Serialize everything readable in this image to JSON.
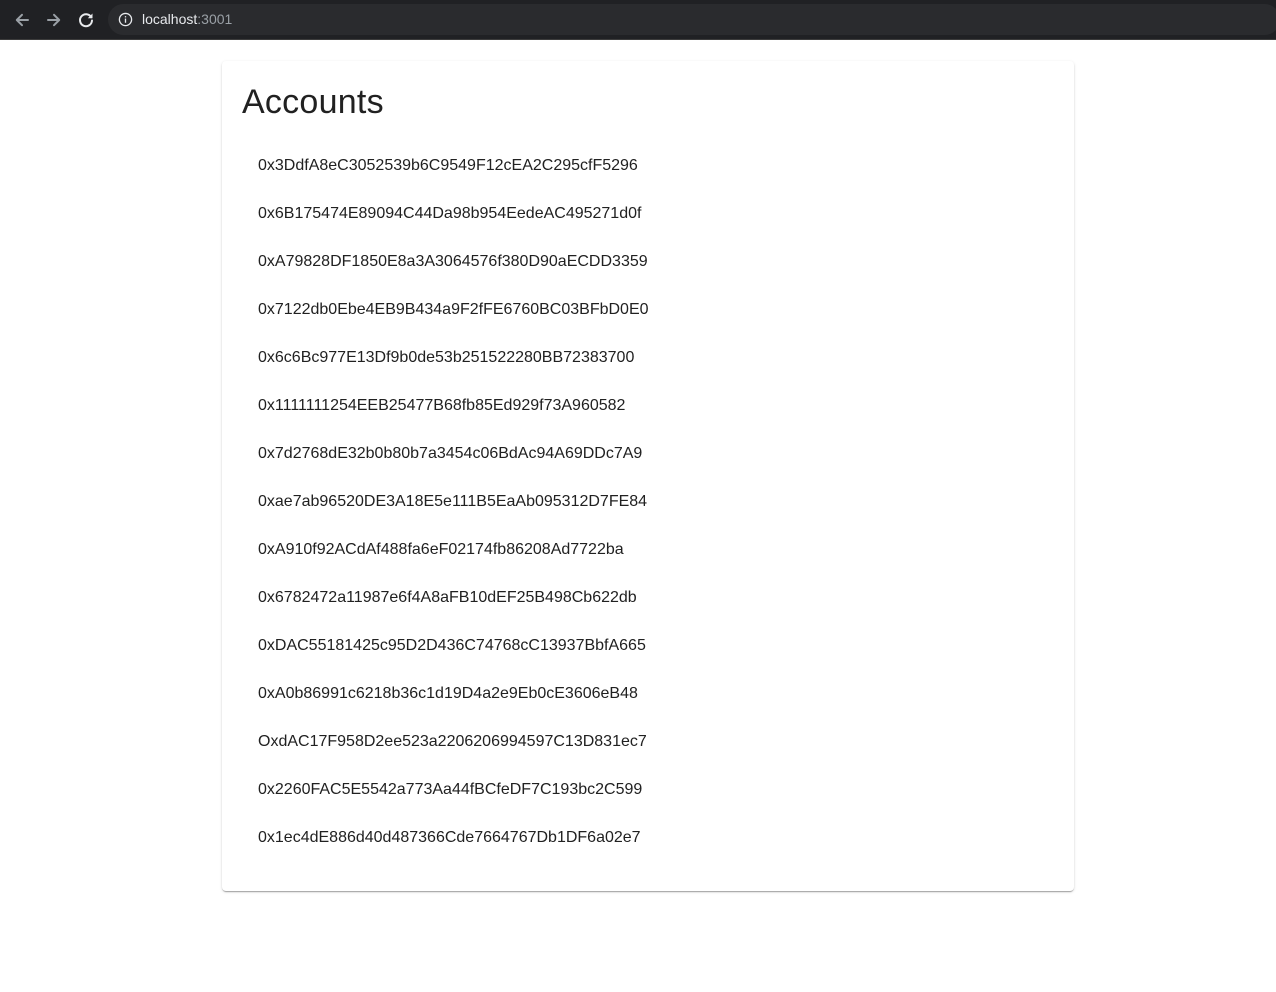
{
  "browser": {
    "url_host": "localhost",
    "url_port": ":3001"
  },
  "page": {
    "title": "Accounts",
    "accounts": [
      "0x3DdfA8eC3052539b6C9549F12cEA2C295cfF5296",
      "0x6B175474E89094C44Da98b954EedeAC495271d0f",
      "0xA79828DF1850E8a3A3064576f380D90aECDD3359",
      "0x7122db0Ebe4EB9B434a9F2fFE6760BC03BFbD0E0",
      "0x6c6Bc977E13Df9b0de53b251522280BB72383700",
      "0x1111111254EEB25477B68fb85Ed929f73A960582",
      "0x7d2768dE32b0b80b7a3454c06BdAc94A69DDc7A9",
      "0xae7ab96520DE3A18E5e111B5EaAb095312D7FE84",
      "0xA910f92ACdAf488fa6eF02174fb86208Ad7722ba",
      "0x6782472a11987e6f4A8aFB10dEF25B498Cb622db",
      "0xDAC55181425c95D2D436C74768cC13937BbfA665",
      "0xA0b86991c6218b36c1d19D4a2e9Eb0cE3606eB48",
      "OxdAC17F958D2ee523a2206206994597C13D831ec7",
      "0x2260FAC5E5542a773Aa44fBCfeDF7C193bc2C599",
      "0x1ec4dE886d40d487366Cde7664767Db1DF6a02e7"
    ]
  }
}
